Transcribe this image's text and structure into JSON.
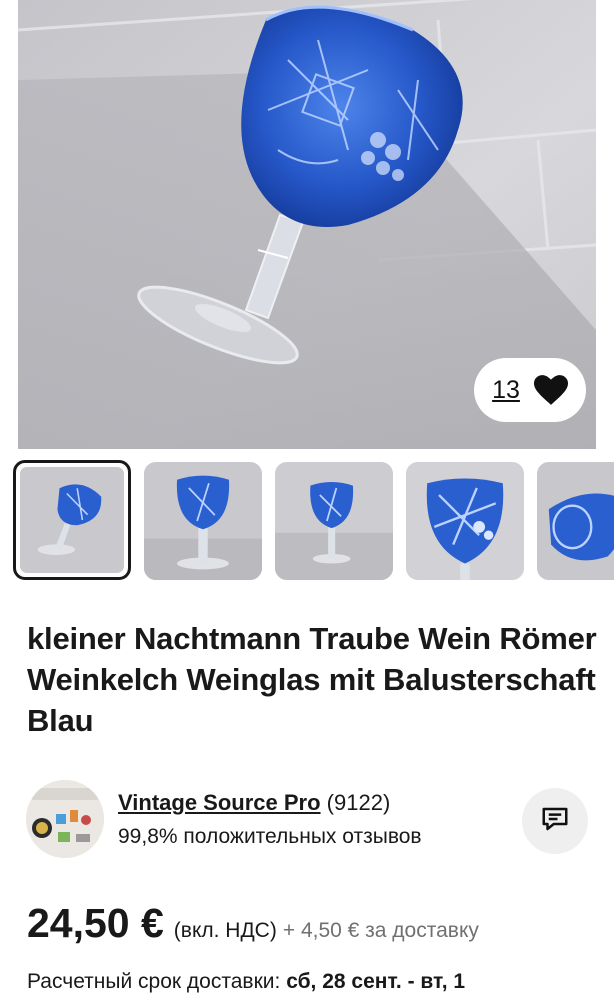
{
  "gallery": {
    "favorite_count": "13",
    "heart_icon": "heart-icon",
    "thumbnail_count": 5,
    "active_thumbnail": 1
  },
  "listing": {
    "title": "kleiner Nachtmann Traube Wein Römer Weinkelch Weinglas mit Balusterschaft Blau"
  },
  "seller": {
    "name": "Vintage Source Pro",
    "rating_count": "(9122)",
    "feedback": "99,8% положительных отзывов",
    "message_icon": "message-icon"
  },
  "price": {
    "amount": "24,50 €",
    "vat_note": "(вкл. НДС)",
    "shipping": "+ 4,50 € за доставку"
  },
  "delivery": {
    "label": "Расчетный срок доставки:",
    "dates": "сб, 28 сент. - вт, 1"
  },
  "colors": {
    "glass_blue": "#2a5fd0",
    "text": "#191919",
    "muted": "#707070"
  }
}
